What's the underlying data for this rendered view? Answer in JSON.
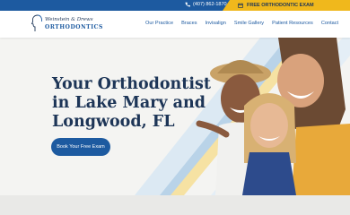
{
  "topbar": {
    "phone": "(407) 862-1870",
    "exam_link": "FREE ORTHODONTIC EXAM",
    "colors": {
      "bar": "#1d5aa0",
      "accent": "#f0b81c"
    }
  },
  "logo": {
    "script_text": "Weinstein & Drews",
    "word": "ORTHODONTICS",
    "mark_icon": "face-profile-icon"
  },
  "nav": {
    "items": [
      {
        "label": "Our Practice"
      },
      {
        "label": "Braces"
      },
      {
        "label": "Invisalign"
      },
      {
        "label": "Smile Gallery"
      },
      {
        "label": "Patient Resources"
      },
      {
        "label": "Contact"
      }
    ]
  },
  "hero": {
    "headline_lines": [
      "Your Orthodontist",
      "in Lake Mary and",
      "Longwood, FL"
    ],
    "cta_label": "Book Your Free Exam",
    "photo": "three-smiling-women-photo"
  }
}
